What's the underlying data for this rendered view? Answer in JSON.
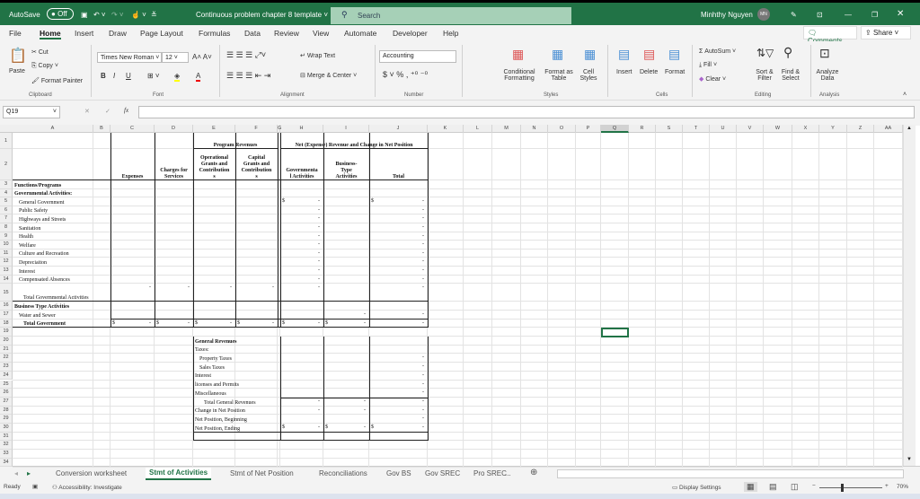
{
  "titlebar": {
    "autosave": "AutoSave",
    "autosave_state": "Off",
    "doc_title": "Continuous problem chapter 8 template",
    "search_placeholder": "Search",
    "user": "Minhthy Nguyen",
    "avatar": "MN"
  },
  "menu": [
    "File",
    "Home",
    "Insert",
    "Draw",
    "Page Layout",
    "Formulas",
    "Data",
    "Review",
    "View",
    "Automate",
    "Developer",
    "Help"
  ],
  "active_menu": "Home",
  "comments": "Comments",
  "share": "Share",
  "ribbon": {
    "clipboard": {
      "paste": "Paste",
      "cut": "Cut",
      "copy": "Copy",
      "format_painter": "Format Painter",
      "label": "Clipboard"
    },
    "font": {
      "name": "Times New Roman",
      "size": "12",
      "bold": "B",
      "italic": "I",
      "underline": "U",
      "label": "Font"
    },
    "alignment": {
      "wrap": "Wrap Text",
      "merge": "Merge & Center",
      "label": "Alignment"
    },
    "number": {
      "format": "Accounting",
      "currency": "$",
      "percent": "%",
      "comma": ",",
      "label": "Number"
    },
    "styles": {
      "conditional": "Conditional Formatting",
      "format_table": "Format as Table",
      "cell_styles": "Cell Styles",
      "label": "Styles"
    },
    "cells": {
      "insert": "Insert",
      "delete": "Delete",
      "format": "Format",
      "label": "Cells"
    },
    "editing": {
      "autosum": "AutoSum",
      "fill": "Fill",
      "clear": "Clear",
      "sort": "Sort & Filter",
      "find": "Find & Select",
      "label": "Editing"
    },
    "analysis": {
      "analyze": "Analyze Data",
      "label": "Analysis"
    }
  },
  "formula_bar": {
    "name_box": "Q19",
    "fx": "fx",
    "value": ""
  },
  "columns": [
    "A",
    "B",
    "C",
    "D",
    "E",
    "F",
    "G",
    "H",
    "I",
    "J",
    "K",
    "L",
    "M",
    "N",
    "O",
    "P",
    "Q",
    "R",
    "S",
    "T",
    "U",
    "V",
    "W",
    "X",
    "Y",
    "Z",
    "AA"
  ],
  "selected_cell": "Q19",
  "rows": [
    {
      "n": "1",
      "cells": [
        {
          "c": "E",
          "t": "Program Revenues",
          "b": true,
          "span": "EF"
        },
        {
          "c": "H",
          "t": "Net (Expense) Revenue and Change in Net Position",
          "b": true,
          "span": "HJ"
        }
      ]
    },
    {
      "n": "2",
      "cells": [
        {
          "c": "C",
          "t": "Expenses",
          "b": true,
          "al": "c"
        },
        {
          "c": "D",
          "t": "Charges for\nServices",
          "b": true,
          "al": "c"
        },
        {
          "c": "E",
          "t": "Operational\nGrants and\nContribution\ns",
          "b": true,
          "al": "c"
        },
        {
          "c": "F",
          "t": "Capital\nGrants and\nContribution\ns",
          "b": true,
          "al": "c"
        },
        {
          "c": "H",
          "t": "Governmenta\nl Activities",
          "b": true,
          "al": "c"
        },
        {
          "c": "I",
          "t": "Business-\nType\nActivities",
          "b": true,
          "al": "c"
        },
        {
          "c": "J",
          "t": "Total",
          "b": true,
          "al": "c"
        }
      ]
    },
    {
      "n": "3",
      "cells": [
        {
          "c": "A",
          "t": "Functions/Programs",
          "b": true
        }
      ]
    },
    {
      "n": "4",
      "cells": [
        {
          "c": "A",
          "t": "Governmental Activities:",
          "b": true
        }
      ]
    },
    {
      "n": "5",
      "cells": [
        {
          "c": "A",
          "t": "General Government",
          "i": 1
        },
        {
          "c": "H",
          "t": "$",
          "d": "-"
        },
        {
          "c": "J",
          "t": "$",
          "d": "-"
        }
      ]
    },
    {
      "n": "6",
      "cells": [
        {
          "c": "A",
          "t": "Public Safety",
          "i": 1
        },
        {
          "c": "H",
          "d": "-"
        },
        {
          "c": "J",
          "d": "-"
        }
      ]
    },
    {
      "n": "7",
      "cells": [
        {
          "c": "A",
          "t": "Highways and Streets",
          "i": 1
        },
        {
          "c": "H",
          "d": "-"
        },
        {
          "c": "J",
          "d": "-"
        }
      ]
    },
    {
      "n": "8",
      "cells": [
        {
          "c": "A",
          "t": "Sanitation",
          "i": 1
        },
        {
          "c": "H",
          "d": "-"
        },
        {
          "c": "J",
          "d": "-"
        }
      ]
    },
    {
      "n": "9",
      "cells": [
        {
          "c": "A",
          "t": "Health",
          "i": 1
        },
        {
          "c": "H",
          "d": "-"
        },
        {
          "c": "J",
          "d": "-"
        }
      ]
    },
    {
      "n": "10",
      "cells": [
        {
          "c": "A",
          "t": "Welfare",
          "i": 1
        },
        {
          "c": "H",
          "d": "-"
        },
        {
          "c": "J",
          "d": "-"
        }
      ]
    },
    {
      "n": "11",
      "cells": [
        {
          "c": "A",
          "t": "Culture and Recreation",
          "i": 1
        },
        {
          "c": "H",
          "d": "-"
        },
        {
          "c": "J",
          "d": "-"
        }
      ]
    },
    {
      "n": "12",
      "cells": [
        {
          "c": "A",
          "t": "Depreciaiton",
          "i": 1
        },
        {
          "c": "H",
          "d": "-"
        },
        {
          "c": "J",
          "d": "-"
        }
      ]
    },
    {
      "n": "13",
      "cells": [
        {
          "c": "A",
          "t": "Interest",
          "i": 1
        },
        {
          "c": "H",
          "d": "-"
        },
        {
          "c": "J",
          "d": "-"
        }
      ]
    },
    {
      "n": "14",
      "cells": [
        {
          "c": "A",
          "t": "Compensated Absences",
          "i": 1
        },
        {
          "c": "H",
          "d": "-"
        },
        {
          "c": "J",
          "d": "-"
        }
      ]
    },
    {
      "n": "15",
      "cells": [
        {
          "c": "A",
          "t": "Total Governmental Activities",
          "i": 2
        },
        {
          "c": "C",
          "d": "-"
        },
        {
          "c": "D",
          "d": "-"
        },
        {
          "c": "E",
          "d": "-"
        },
        {
          "c": "F",
          "d": "-"
        },
        {
          "c": "H",
          "d": "-"
        },
        {
          "c": "J",
          "d": "-"
        }
      ]
    },
    {
      "n": "16",
      "cells": [
        {
          "c": "A",
          "t": "Business Type Activities",
          "b": true
        }
      ]
    },
    {
      "n": "17",
      "cells": [
        {
          "c": "A",
          "t": "Water and Sewer",
          "i": 1
        },
        {
          "c": "I",
          "d": "-"
        },
        {
          "c": "J",
          "d": "-"
        }
      ]
    },
    {
      "n": "18",
      "cells": [
        {
          "c": "A",
          "t": "Total Government",
          "b": true,
          "i": 2
        },
        {
          "c": "C",
          "t": "$",
          "d": "-"
        },
        {
          "c": "D",
          "t": "$",
          "d": "-"
        },
        {
          "c": "E",
          "t": "$",
          "d": "-"
        },
        {
          "c": "F",
          "t": "$",
          "d": "-"
        },
        {
          "c": "H",
          "t": "$",
          "d": "-"
        },
        {
          "c": "I",
          "t": "$",
          "d": "-"
        },
        {
          "c": "J",
          "d": "-"
        }
      ]
    },
    {
      "n": "19",
      "cells": []
    },
    {
      "n": "20",
      "cells": [
        {
          "c": "E",
          "t": "General Revenues",
          "b": true
        }
      ]
    },
    {
      "n": "21",
      "cells": [
        {
          "c": "E",
          "t": "Taxes:"
        }
      ]
    },
    {
      "n": "22",
      "cells": [
        {
          "c": "E",
          "t": "Property Taxes",
          "i": 1
        },
        {
          "c": "J",
          "d": "-"
        }
      ]
    },
    {
      "n": "23",
      "cells": [
        {
          "c": "E",
          "t": "Sales Taxes",
          "i": 1
        },
        {
          "c": "J",
          "d": "-"
        }
      ]
    },
    {
      "n": "24",
      "cells": [
        {
          "c": "E",
          "t": "Interest"
        },
        {
          "c": "J",
          "d": "-"
        }
      ]
    },
    {
      "n": "25",
      "cells": [
        {
          "c": "E",
          "t": "licenses and Permits"
        },
        {
          "c": "J",
          "d": "-"
        }
      ]
    },
    {
      "n": "26",
      "cells": [
        {
          "c": "E",
          "t": "Miscellaneous"
        },
        {
          "c": "J",
          "d": "-"
        }
      ]
    },
    {
      "n": "27",
      "cells": [
        {
          "c": "E",
          "t": "Total General Revenues",
          "i": 2
        },
        {
          "c": "H",
          "d": "-"
        },
        {
          "c": "I",
          "d": "-"
        },
        {
          "c": "J",
          "d": "-"
        }
      ]
    },
    {
      "n": "28",
      "cells": [
        {
          "c": "E",
          "t": "Change in Net Position"
        },
        {
          "c": "H",
          "d": "-"
        },
        {
          "c": "I",
          "d": "-"
        },
        {
          "c": "J",
          "d": "-"
        }
      ]
    },
    {
      "n": "29",
      "cells": [
        {
          "c": "E",
          "t": "Net Position, Beginning"
        },
        {
          "c": "J",
          "d": "-"
        }
      ]
    },
    {
      "n": "30",
      "cells": [
        {
          "c": "E",
          "t": "Net Position, Ending"
        },
        {
          "c": "H",
          "t": "$",
          "d": "-"
        },
        {
          "c": "I",
          "t": "$",
          "d": "-"
        },
        {
          "c": "J",
          "t": "$",
          "d": "-"
        }
      ]
    },
    {
      "n": "31",
      "cells": []
    },
    {
      "n": "32",
      "cells": []
    },
    {
      "n": "33",
      "cells": []
    },
    {
      "n": "34",
      "cells": []
    }
  ],
  "sheet_tabs": [
    "Conversion worksheet",
    "Stmt of Activities",
    "Stmt of Net Position",
    "Reconciliations",
    "Gov BS",
    "Gov SREC",
    "Pro SREC",
    "..."
  ],
  "active_tab": "Stmt of Activities",
  "status": {
    "ready": "Ready",
    "accessibility": "Accessibility: Investigate",
    "display_settings": "Display Settings",
    "zoom": "70%",
    "zoom_value": 70
  },
  "colors": {
    "brand": "#217346",
    "search": "#a6d0b7"
  }
}
